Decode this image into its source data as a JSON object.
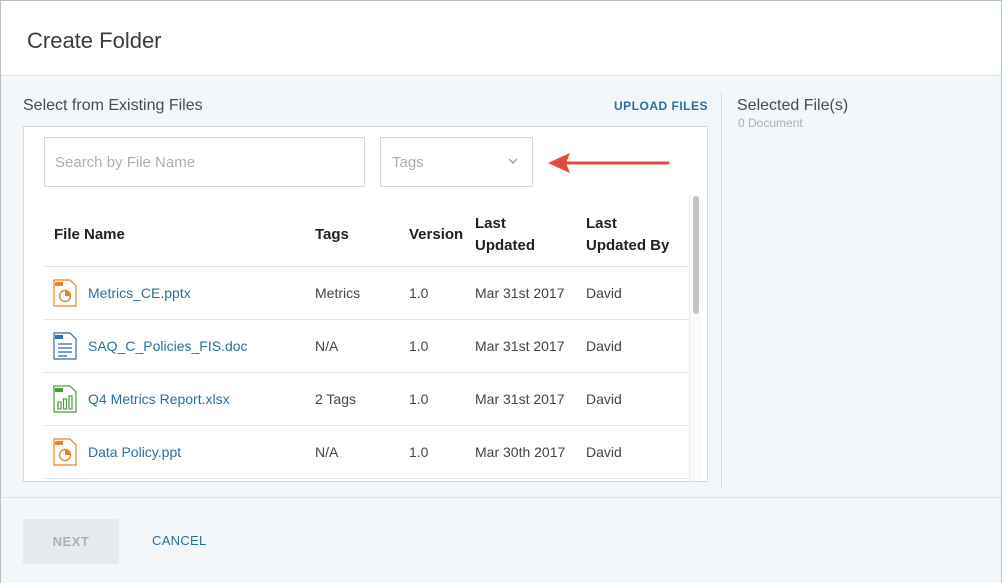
{
  "dialog": {
    "title": "Create Folder"
  },
  "left": {
    "title": "Select from Existing Files",
    "upload_label": "UPLOAD FILES",
    "search": {
      "placeholder": "Search by File Name",
      "value": ""
    },
    "tags_filter": {
      "label": "Tags",
      "icon": "chevron-down-icon"
    },
    "annotation": {
      "icon": "red-arrow-pointer",
      "color": "#e14a3c"
    }
  },
  "table": {
    "columns": [
      {
        "line1": "File Name",
        "line2": ""
      },
      {
        "line1": "Tags",
        "line2": ""
      },
      {
        "line1": "Version",
        "line2": ""
      },
      {
        "line1": "Last",
        "line2": "Updated"
      },
      {
        "line1": "Last",
        "line2": "Updated By"
      }
    ],
    "rows": [
      {
        "icon": "ppt-file-icon",
        "name": "Metrics_CE.pptx",
        "tags": "Metrics",
        "version": "1.0",
        "updated": "Mar 31st 2017",
        "by": "David"
      },
      {
        "icon": "doc-file-icon",
        "name": "SAQ_C_Policies_FIS.doc",
        "tags": "N/A",
        "version": "1.0",
        "updated": "Mar 31st 2017",
        "by": "David"
      },
      {
        "icon": "xls-file-icon",
        "name": "Q4 Metrics Report.xlsx",
        "tags": "2 Tags",
        "version": "1.0",
        "updated": "Mar 31st 2017",
        "by": "David"
      },
      {
        "icon": "ppt-file-icon",
        "name": "Data Policy.ppt",
        "tags": "N/A",
        "version": "1.0",
        "updated": "Mar 30th 2017",
        "by": "David"
      }
    ]
  },
  "right": {
    "title": "Selected File(s)",
    "count": "0 Document"
  },
  "footer": {
    "next_label": "NEXT",
    "cancel_label": "CANCEL"
  },
  "colors": {
    "accent": "#2b6f9e",
    "ppt": "#e8822a",
    "doc": "#2f6fb0",
    "xls": "#4c9a3a"
  }
}
